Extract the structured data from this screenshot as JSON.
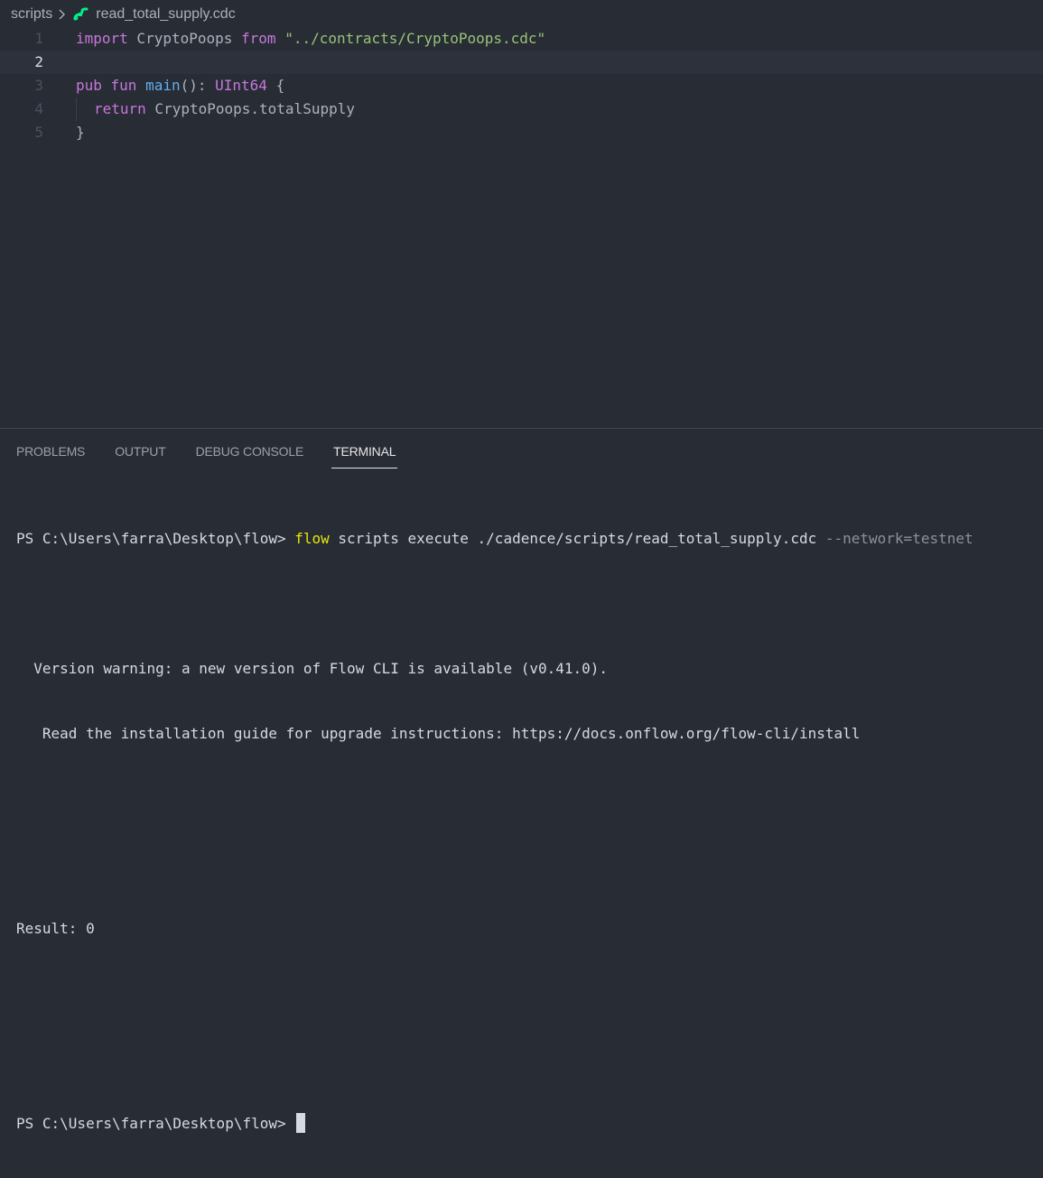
{
  "breadcrumb": {
    "folder": "scripts",
    "file": "read_total_supply.cdc"
  },
  "editor": {
    "lines": [
      {
        "n": "1"
      },
      {
        "n": "2"
      },
      {
        "n": "3"
      },
      {
        "n": "4"
      },
      {
        "n": "5"
      }
    ],
    "tokens": {
      "l1_import": "import",
      "l1_name": " CryptoPoops ",
      "l1_from": "from",
      "l1_path": " \"../contracts/CryptoPoops.cdc\"",
      "l3_pub": "pub",
      "l3_fun": " fun ",
      "l3_main": "main",
      "l3_parens": "(): ",
      "l3_type": "UInt64",
      "l3_brace": " {",
      "l4_return": "return",
      "l4_expr": " CryptoPoops.totalSupply",
      "l5_brace": "}"
    }
  },
  "panel": {
    "tabs": [
      "PROBLEMS",
      "OUTPUT",
      "DEBUG CONSOLE",
      "TERMINAL"
    ],
    "active_tab": "TERMINAL"
  },
  "terminal": {
    "prompt1": "PS C:\\Users\\farra\\Desktop\\flow> ",
    "cmd_flow": "flow",
    "cmd_args": " scripts execute ./cadence/scripts/read_total_supply.cdc ",
    "cmd_flag": "--network=testnet",
    "warn1": "  Version warning: a new version of Flow CLI is available (v0.41.0).",
    "warn2": "   Read the installation guide for upgrade instructions: https://docs.onflow.org/flow-cli/install",
    "result": "Result: 0",
    "prompt2": "PS C:\\Users\\farra\\Desktop\\flow> "
  },
  "colors": {
    "background": "#282c34",
    "flow_icon": "#00ef8b",
    "keyword": "#c678dd",
    "string": "#98c379",
    "function": "#61afef",
    "type": "#e5c07b"
  }
}
